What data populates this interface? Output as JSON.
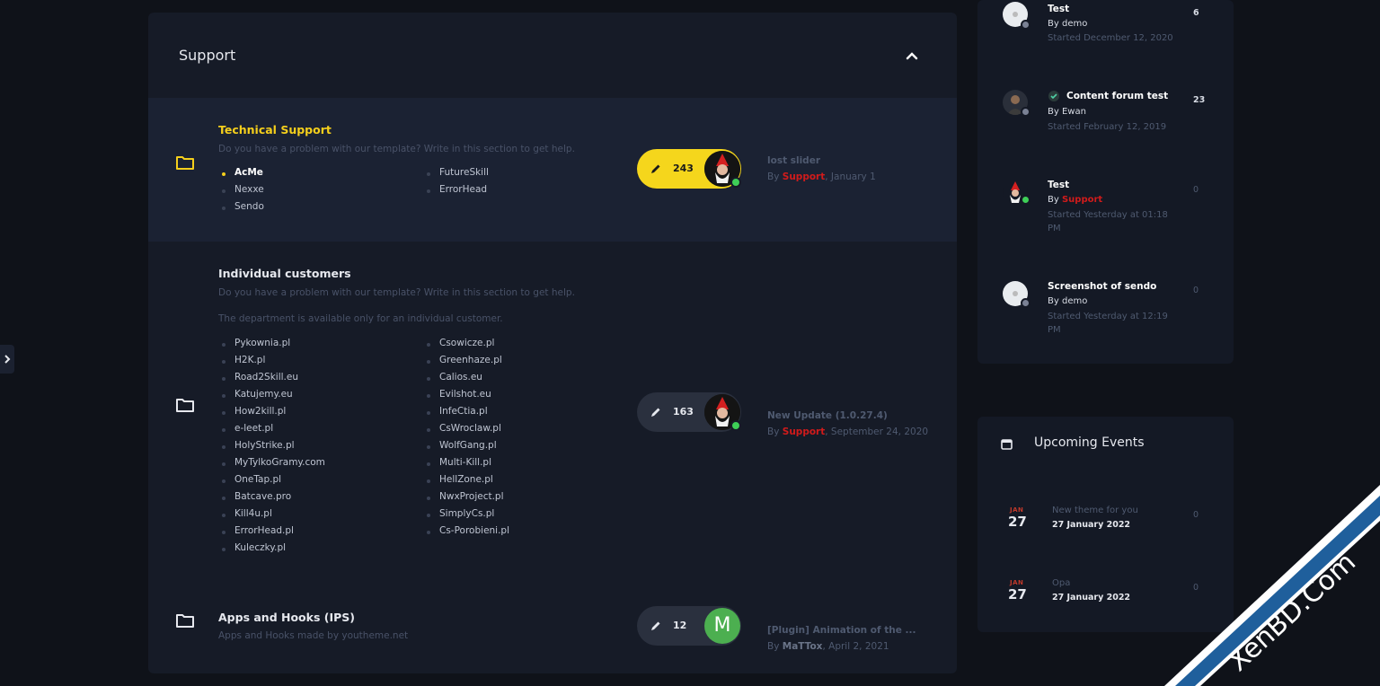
{
  "section": {
    "title": "Support"
  },
  "categories": [
    {
      "name": "Technical Support",
      "description": "Do you have a problem with our template? Write in this section to get help.",
      "subforums_col1": [
        "AcMe",
        "Nexxe",
        "Sendo"
      ],
      "subforums_col2": [
        "FutureSkill",
        "ErrorHead"
      ],
      "posts": "243",
      "last_post": {
        "title": "lost slider",
        "by_prefix": "By ",
        "author": "Support",
        "date": ", January 1"
      }
    },
    {
      "name": "Individual customers",
      "description": "Do you have a problem with our template? Write in this section to get help.",
      "note": "The department is available only for an individual customer.",
      "subforums_col1": [
        "Pykownia.pl",
        "H2K.pl",
        "Road2Skill.eu",
        "Katujemy.eu",
        "How2kill.pl",
        "e-leet.pl",
        "HolyStrike.pl",
        "MyTylkoGramy.com",
        "OneTap.pl",
        "Batcave.pro",
        "Kill4u.pl",
        "ErrorHead.pl",
        "Kuleczky.pl"
      ],
      "subforums_col2": [
        "Csowicze.pl",
        "Greenhaze.pl",
        "Calios.eu",
        "Evilshot.eu",
        "InfeCtia.pl",
        "CsWroclaw.pl",
        "WolfGang.pl",
        "Multi-Kill.pl",
        "HellZone.pl",
        "NwxProject.pl",
        "SimplyCs.pl",
        "Cs-Porobieni.pl"
      ],
      "posts": "163",
      "last_post": {
        "title": "New Update (1.0.27.4)",
        "by_prefix": "By ",
        "author": "Support",
        "date": ", September 24, 2020"
      }
    },
    {
      "name": "Apps and Hooks (IPS)",
      "description": "Apps and Hooks made by youtheme.net",
      "posts": "12",
      "avatar_letter": "M",
      "last_post": {
        "title": "[Plugin] Animation of the ...",
        "by_prefix": "By ",
        "author": "MaTTox",
        "date": ", April 2, 2021"
      }
    }
  ],
  "topics": [
    {
      "title": "Test",
      "by_prefix": "By ",
      "author": "demo",
      "started": "Started December 12, 2020",
      "count": "6"
    },
    {
      "title": "Content forum test",
      "by_prefix": "By ",
      "author": "Ewan",
      "started": "Started February 12, 2019",
      "count": "23"
    },
    {
      "title": "Test",
      "by_prefix": "By ",
      "author": "Support",
      "started": "Started Yesterday at 01:18 PM",
      "count": "0"
    },
    {
      "title": "Screenshot of sendo",
      "by_prefix": "By ",
      "author": "demo",
      "started": "Started Yesterday at 12:19 PM",
      "count": "0"
    }
  ],
  "events": {
    "title": "Upcoming Events",
    "items": [
      {
        "month": "JAN",
        "day": "27",
        "name": "New theme for you",
        "date": "27 January 2022",
        "count": "0"
      },
      {
        "month": "JAN",
        "day": "27",
        "name": "Opa",
        "date": "27 January 2022",
        "count": "0"
      }
    ]
  },
  "watermark": {
    "text": "XenBD.Com"
  },
  "colors": {
    "accent": "#f5d61c",
    "author_red": "#d11b1b",
    "online": "#3ecf57",
    "avatar_green": "#4caf50"
  },
  "icons": [
    "folder-icon",
    "pencil-icon",
    "chevron-up-icon",
    "calendar-icon",
    "check-badge-icon",
    "chevron-right-icon"
  ]
}
